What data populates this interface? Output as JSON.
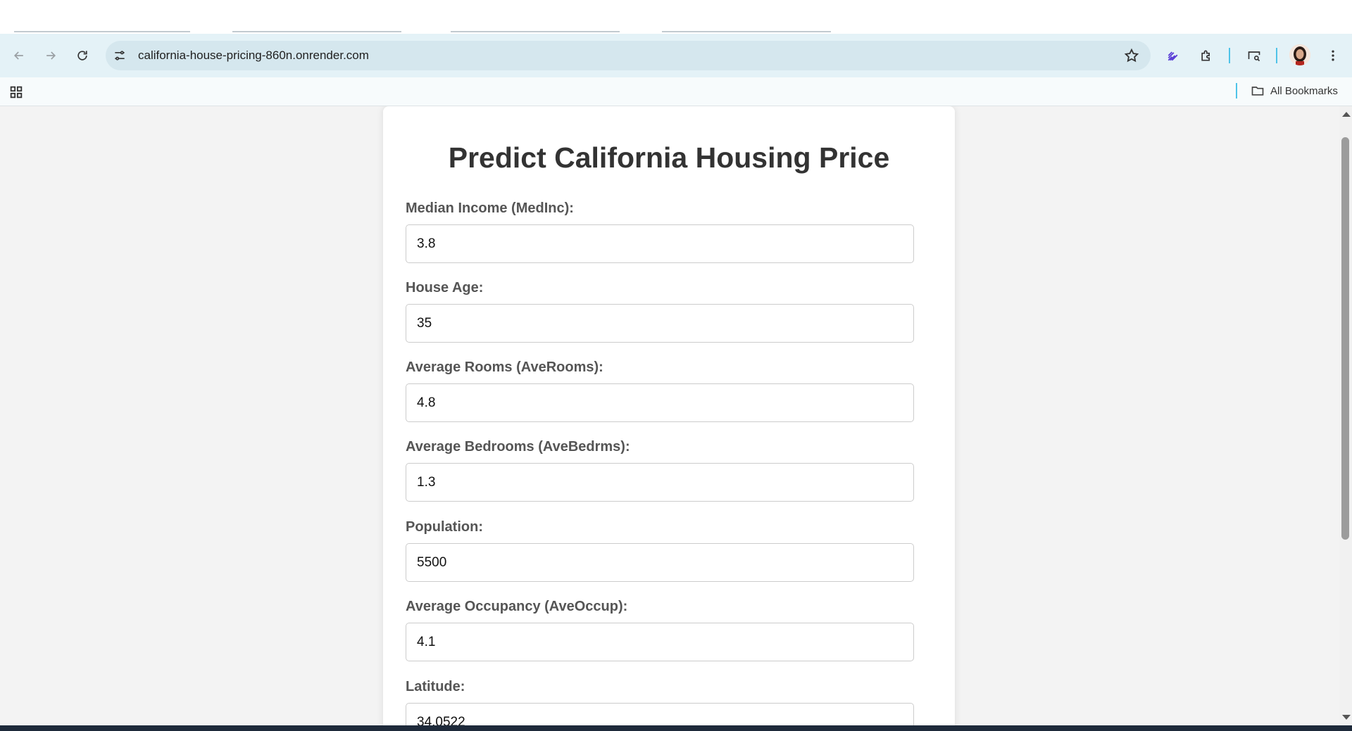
{
  "browser": {
    "url": "california-house-pricing-860n.onrender.com",
    "bookmarks_label": "All Bookmarks",
    "accent_color": "#4fc3e8"
  },
  "icons": {
    "back": "arrow-left-icon",
    "forward": "arrow-right-icon",
    "reload": "reload-icon",
    "site_info": "tune-icon",
    "bookmark": "star-icon",
    "extension_1": "rocket-extension-icon",
    "extensions": "puzzle-icon",
    "cast": "cast-search-icon",
    "menu": "kebab-menu-icon",
    "apps": "apps-grid-icon",
    "folder": "folder-icon"
  },
  "page": {
    "title": "Predict California Housing Price",
    "fields": [
      {
        "label": "Median Income (MedInc):",
        "value": "3.8"
      },
      {
        "label": "House Age:",
        "value": "35"
      },
      {
        "label": "Average Rooms (AveRooms):",
        "value": "4.8"
      },
      {
        "label": "Average Bedrooms (AveBedrms):",
        "value": "1.3"
      },
      {
        "label": "Population:",
        "value": "5500"
      },
      {
        "label": "Average Occupancy (AveOccup):",
        "value": "4.1"
      },
      {
        "label": "Latitude:",
        "value": "34.0522"
      }
    ]
  }
}
